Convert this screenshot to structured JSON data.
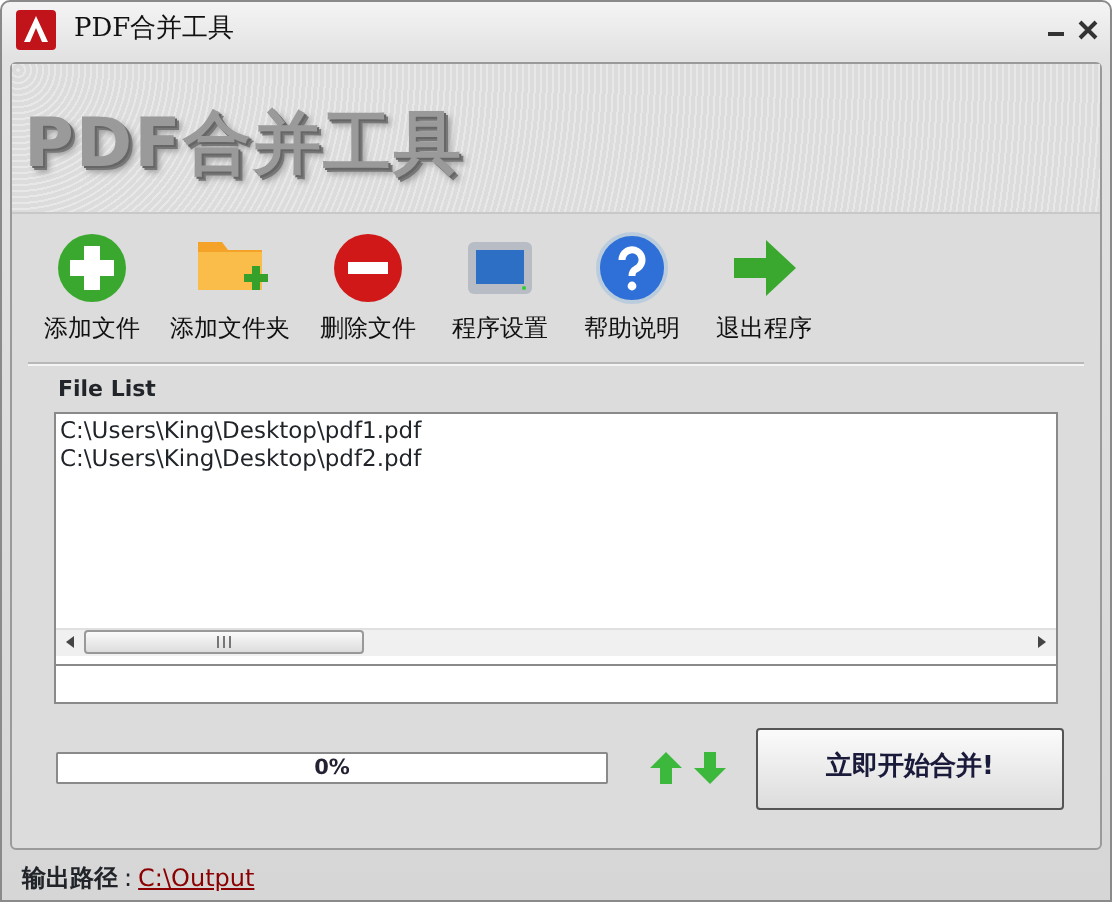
{
  "window": {
    "title": "PDF合并工具"
  },
  "banner": {
    "title": "PDF合并工具"
  },
  "toolbar": [
    {
      "kind": "add",
      "label": "添加文件"
    },
    {
      "kind": "folder",
      "label": "添加文件夹"
    },
    {
      "kind": "remove",
      "label": "删除文件"
    },
    {
      "kind": "settings",
      "label": "程序设置"
    },
    {
      "kind": "help",
      "label": "帮助说明"
    },
    {
      "kind": "exit",
      "label": "退出程序"
    }
  ],
  "file_list": {
    "title": "File List",
    "items": [
      "C:\\Users\\King\\Desktop\\pdf1.pdf",
      "C:\\Users\\King\\Desktop\\pdf2.pdf"
    ]
  },
  "progress": {
    "level": 0,
    "reading": "0%"
  },
  "merge_button": "立即开始合并!",
  "output": {
    "label": "输出路径",
    "separator": ":",
    "path": "C:\\Output"
  }
}
